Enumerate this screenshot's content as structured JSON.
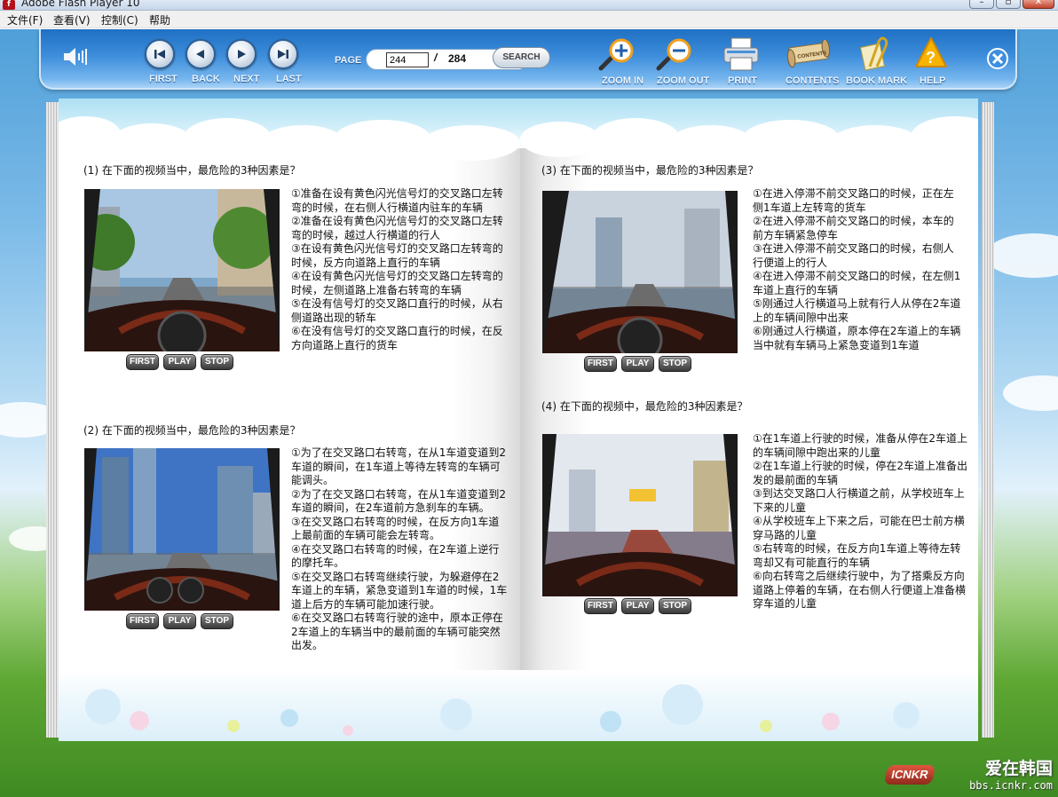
{
  "window": {
    "title": "Adobe Flash Player 10",
    "app_icon": "f"
  },
  "menu": [
    "文件(F)",
    "查看(V)",
    "控制(C)",
    "帮助"
  ],
  "toolbar": {
    "nav": {
      "first": "FIRST",
      "back": "BACK",
      "next": "NEXT",
      "last": "LAST"
    },
    "page_label": "PAGE",
    "current_page": "244",
    "slash": "/",
    "total_pages": "284",
    "search": "SEARCH",
    "tools": {
      "zoom_in": "ZOOM IN",
      "zoom_out": "ZOOM OUT",
      "print": "PRINT",
      "contents": "CONTENTS",
      "bookmark": "BOOK MARK",
      "help": "HELP"
    },
    "contents_scroll_text": "CONTENTS"
  },
  "video_buttons": {
    "first": "FIRST",
    "play": "PLAY",
    "stop": "STOP"
  },
  "questions": [
    {
      "title": "(1) 在下面的视频当中，最危险的3种因素是？",
      "options": [
        "①准备在设有黄色闪光信号灯的交叉路口左转弯的时候，在右侧人行横道内驻车的车辆",
        "②准备在设有黄色闪光信号灯的交叉路口左转弯的时候，越过人行横道的行人",
        "③在设有黄色闪光信号灯的交叉路口左转弯的时候，反方向道路上直行的车辆",
        "④在设有黄色闪光信号灯的交叉路口左转弯的时候，左侧道路上准备右转弯的车辆",
        "⑤在没有信号灯的交叉路口直行的时候，从右侧道路出现的轿车",
        "⑥在没有信号灯的交叉路口直行的时候，在反方向道路上直行的货车"
      ]
    },
    {
      "title": "(2) 在下面的视频当中，最危险的3种因素是？",
      "options": [
        "①为了在交叉路口右转弯，在从1车道变道到2车道的瞬间，在1车道上等待左转弯的车辆可能调头。",
        "②为了在交叉路口右转弯，在从1车道变道到2车道的瞬间，在2车道前方急刹车的车辆。",
        "③在交叉路口右转弯的时候，在反方向1车道上最前面的车辆可能会左转弯。",
        "④在交叉路口右转弯的时候，在2车道上逆行的摩托车。",
        "⑤在交叉路口右转弯继续行驶，为躲避停在2车道上的车辆，紧急变道到1车道的时候，1车道上后方的车辆可能加速行驶。",
        "⑥在交叉路口右转弯行驶的途中，原本正停在2车道上的车辆当中的最前面的车辆可能突然出发。"
      ]
    },
    {
      "title": "(3) 在下面的视频当中，最危险的3种因素是？",
      "options": [
        "①在进入停滞不前交叉路口的时候，正在左侧1车道上左转弯的货车",
        "②在进入停滞不前交叉路口的时候，本车的前方车辆紧急停车",
        "③在进入停滞不前交叉路口的时候，右侧人行便道上的行人",
        "④在进入停滞不前交叉路口的时候，在左侧1车道上直行的车辆",
        "⑤刚通过人行横道马上就有行人从停在2车道上的车辆间隙中出来",
        "⑥刚通过人行横道，原本停在2车道上的车辆当中就有车辆马上紧急变道到1车道"
      ]
    },
    {
      "title": "(4) 在下面的视频中，最危险的3种因素是？",
      "options": [
        "①在1车道上行驶的时候，准备从停在2车道上的车辆间隙中跑出来的儿童",
        "②在1车道上行驶的时候，停在2车道上准备出发的最前面的车辆",
        "③到达交叉路口人行横道之前，从学校班车上下来的儿童",
        "④从学校班车上下来之后，可能在巴士前方横穿马路的儿童",
        "⑤右转弯的时候，在反方向1车道上等待左转弯却又有可能直行的车辆",
        "⑥向右转弯之后继续行驶中，为了搭乘反方向道路上停着的车辆，在右侧人行便道上准备横穿车道的儿童"
      ]
    }
  ],
  "watermark": {
    "logo": "ICNKR",
    "text": "爱在韩国",
    "url": "bbs.icnkr.com"
  }
}
